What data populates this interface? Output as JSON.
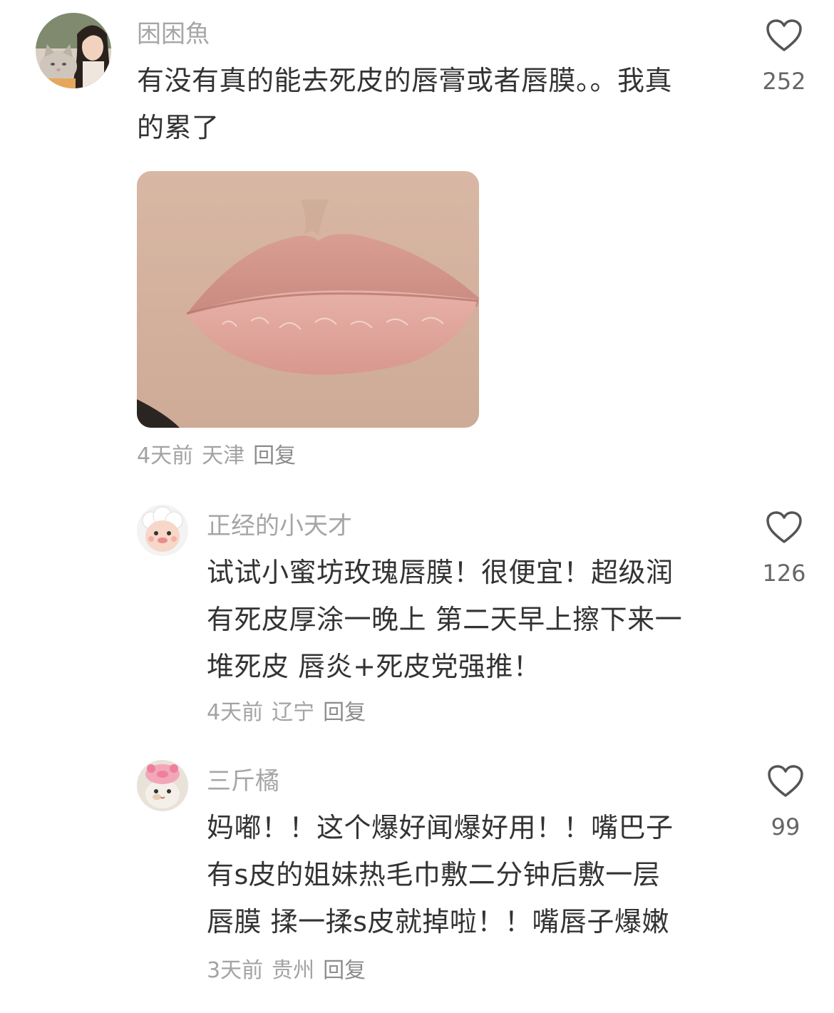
{
  "comments": [
    {
      "username": "困困魚",
      "avatar": "avatar-girl-with-cat",
      "lines": [
        "有没有真的能去死皮的唇膏或者唇膜。。我真",
        "的累了"
      ],
      "image": "lips-photo",
      "time": "4天前",
      "location": "天津",
      "reply_label": "回复",
      "likes": "252"
    },
    {
      "username": "正经的小天才",
      "avatar": "avatar-cartoon-sheep",
      "lines": [
        "试试小蜜坊玫瑰唇膜！很便宜！超级润",
        "有死皮厚涂一晚上 第二天早上擦下来一",
        "堆死皮 唇炎+死皮党强推！"
      ],
      "time": "4天前",
      "location": "辽宁",
      "reply_label": "回复",
      "likes": "126"
    },
    {
      "username": "三斤橘",
      "avatar": "avatar-cat-pink-hat",
      "lines": [
        "妈嘟！！这个爆好闻爆好用！！嘴巴子",
        "有s皮的姐妹热毛巾敷二分钟后敷一层",
        "唇膜 揉一揉s皮就掉啦！！嘴唇子爆嫩"
      ],
      "time": "3天前",
      "location": "贵州",
      "reply_label": "回复",
      "likes": "99"
    }
  ],
  "icons": {
    "like": "heart-outline-icon"
  },
  "colors": {
    "username": "#a6a6a6",
    "text": "#333333",
    "meta": "#a3a3a3",
    "heart": "#555555"
  }
}
